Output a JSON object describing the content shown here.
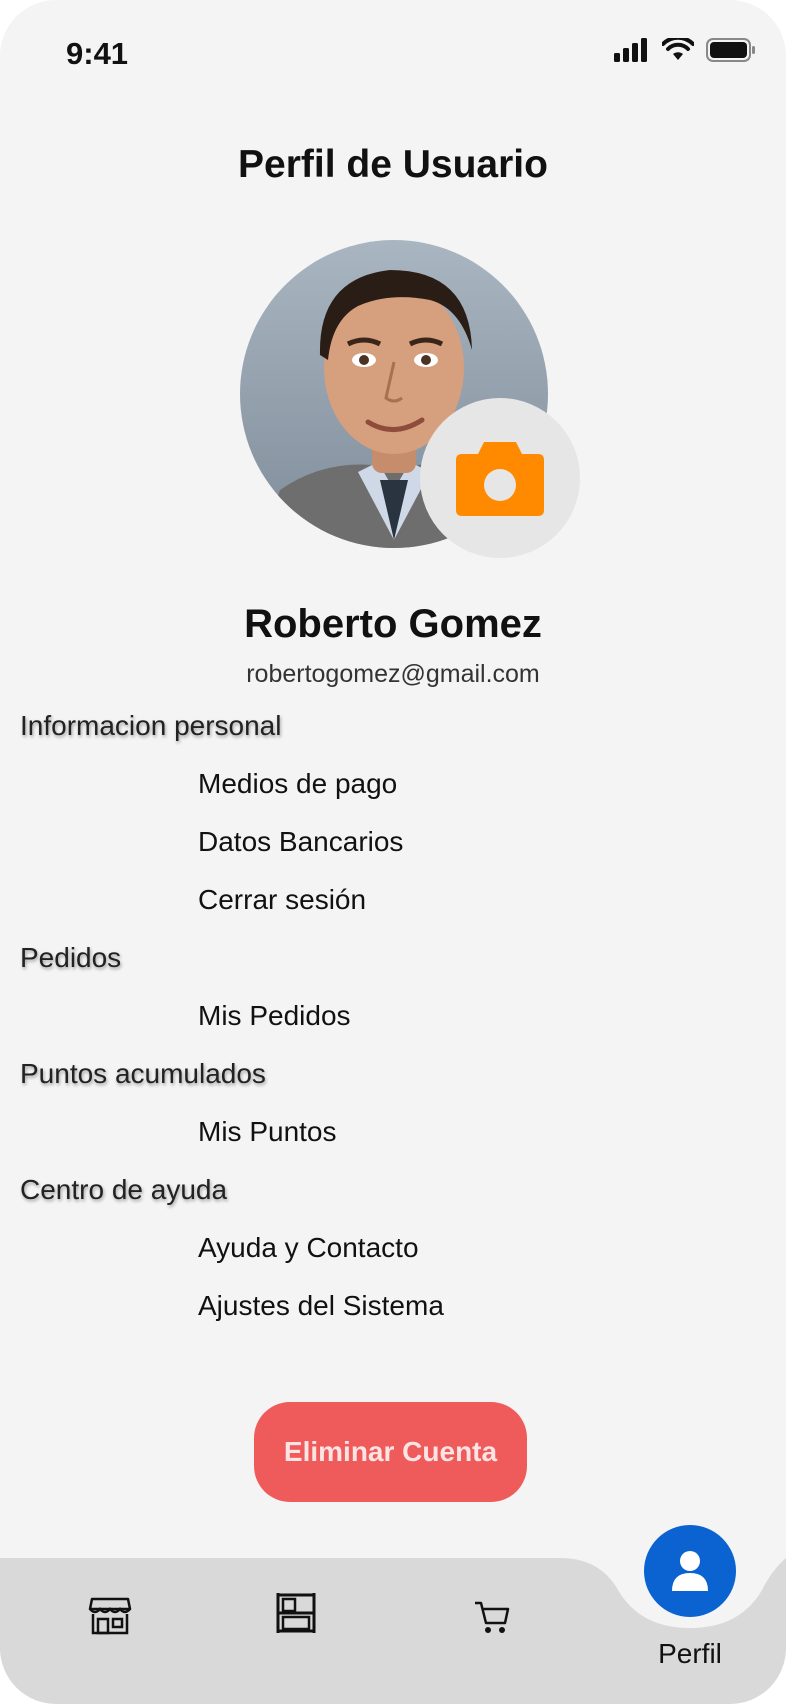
{
  "status_bar": {
    "time": "9:41"
  },
  "page": {
    "title": "Perfil de Usuario"
  },
  "user": {
    "name": "Roberto Gomez",
    "email": "robertogomez@gmail.com"
  },
  "sections": [
    {
      "header": "Informacion personal",
      "items": [
        "Medios de pago",
        "Datos Bancarios",
        "Cerrar sesión"
      ]
    },
    {
      "header": "Pedidos",
      "items": [
        "Mis Pedidos"
      ]
    },
    {
      "header": "Puntos acumulados",
      "items": [
        "Mis Puntos"
      ]
    },
    {
      "header": "Centro de ayuda",
      "items": [
        "Ayuda y Contacto",
        "Ajustes del Sistema"
      ]
    }
  ],
  "actions": {
    "delete_account": "Eliminar Cuenta"
  },
  "nav": {
    "profile_label": "Perfil",
    "items": [
      "store-icon",
      "shelf-icon",
      "cart-icon",
      "user-icon"
    ]
  },
  "colors": {
    "accent_orange": "#ff8a00",
    "danger": "#ef5a5a",
    "primary_blue": "#0a63d1",
    "background": "#f4f4f4",
    "nav_background": "#d9d9d9"
  }
}
